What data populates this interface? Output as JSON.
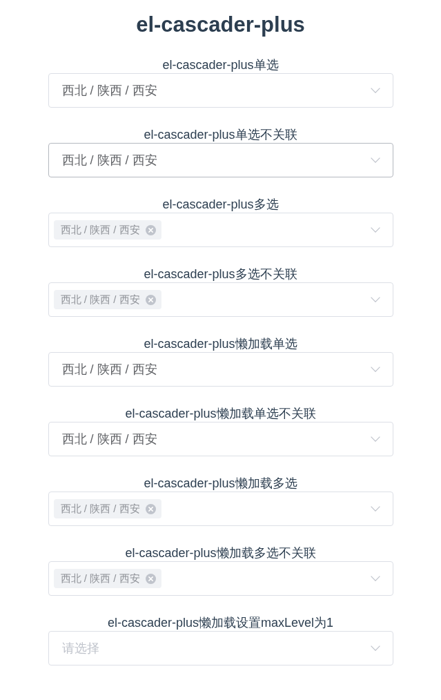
{
  "title": "el-cascader-plus",
  "sections": [
    {
      "label": "el-cascader-plus单选",
      "field": {
        "kind": "single",
        "value": "西北 / 陕西 / 西安",
        "hovered": false
      }
    },
    {
      "label": "el-cascader-plus单选不关联",
      "field": {
        "kind": "single",
        "value": "西北 / 陕西 / 西安",
        "hovered": true
      }
    },
    {
      "label": "el-cascader-plus多选",
      "field": {
        "kind": "multiple",
        "tags": [
          "西北 / 陕西 / 西安"
        ],
        "hovered": false
      }
    },
    {
      "label": "el-cascader-plus多选不关联",
      "field": {
        "kind": "multiple",
        "tags": [
          "西北 / 陕西 / 西安"
        ],
        "hovered": false
      }
    },
    {
      "label": "el-cascader-plus懒加载单选",
      "field": {
        "kind": "single",
        "value": "西北 / 陕西 / 西安",
        "hovered": false
      }
    },
    {
      "label": "el-cascader-plus懒加载单选不关联",
      "field": {
        "kind": "single",
        "value": "西北 / 陕西 / 西安",
        "hovered": false
      }
    },
    {
      "label": "el-cascader-plus懒加载多选",
      "field": {
        "kind": "multiple",
        "tags": [
          "西北 / 陕西 / 西安"
        ],
        "hovered": false
      }
    },
    {
      "label": "el-cascader-plus懒加载多选不关联",
      "field": {
        "kind": "multiple",
        "tags": [
          "西北 / 陕西 / 西安"
        ],
        "hovered": false
      }
    },
    {
      "label": "el-cascader-plus懒加载设置maxLevel为1",
      "field": {
        "kind": "single",
        "placeholder": "请选择",
        "hovered": false
      }
    }
  ]
}
